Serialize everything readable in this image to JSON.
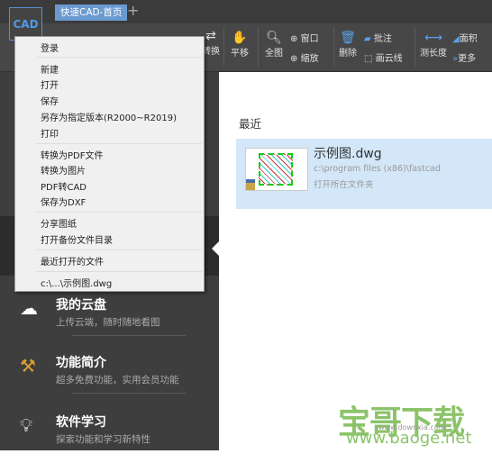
{
  "app": {
    "logo_text": "CAD",
    "tab": "快速CAD-首页",
    "new_tab": "+"
  },
  "toolbar": {
    "items": [
      "转换",
      "平移",
      "全图",
      "窗口",
      "缩放",
      "删除",
      "批注",
      "画云线",
      "测长度",
      "面积",
      "更多"
    ]
  },
  "menu": {
    "items": [
      "登录",
      "新建",
      "打开",
      "保存",
      "另存为指定版本(R2000~R2019)",
      "打印",
      "转换为PDF文件",
      "转换为图片",
      "PDF转CAD",
      "保存为DXF",
      "分享图纸",
      "打开备份文件目录",
      "最近打开的文件",
      "c:\\...\\示例图.dwg"
    ]
  },
  "sidebar": {
    "items": [
      {
        "title": "我的云盘",
        "sub": "上传云端，随时随地看图",
        "icon": "cloud-icon"
      },
      {
        "title": "功能简介",
        "sub": "超多免费功能，实用会员功能",
        "icon": "tools-icon"
      },
      {
        "title": "软件学习",
        "sub": "探索功能和学习新特性",
        "icon": "lightbulb-icon"
      }
    ]
  },
  "main": {
    "section": "最近",
    "file": {
      "name": "示例图.dwg",
      "path": "c:\\program files (x86)\\fastcad",
      "open_folder": "打开所在文件夹"
    }
  },
  "watermark": {
    "text": "宝哥下载",
    "url": "www.baoge.net",
    "url2": "www.downxia.com"
  }
}
